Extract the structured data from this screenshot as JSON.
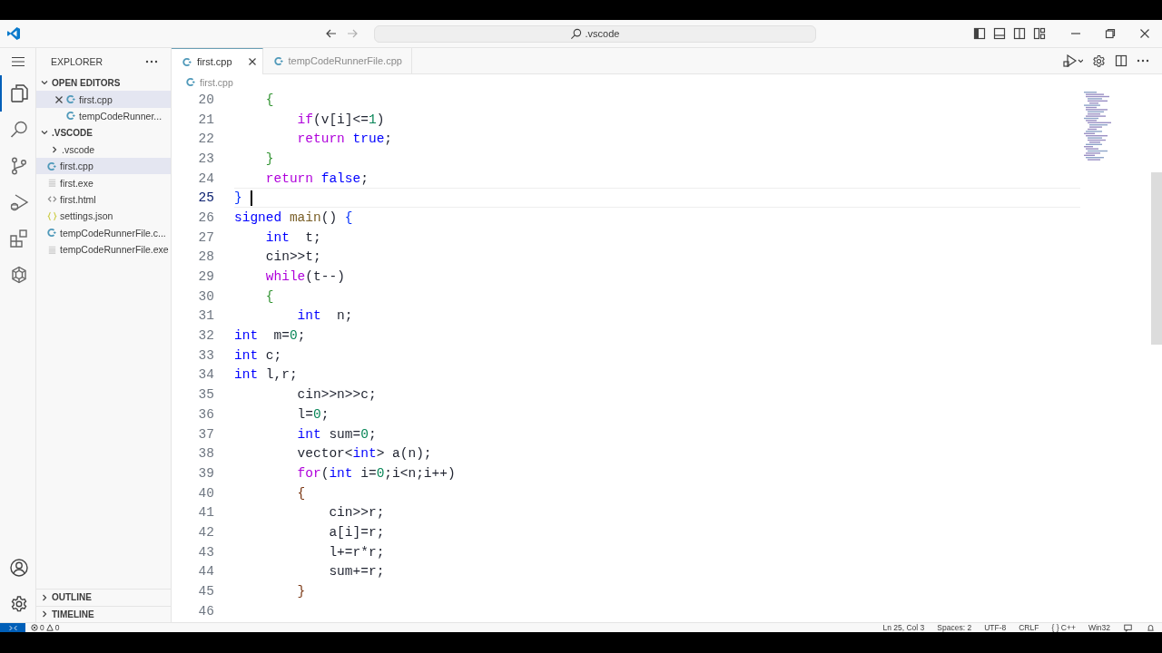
{
  "title_bar": {
    "search": ".vscode"
  },
  "activity_bar": {
    "items": [
      {
        "kind": "explorer",
        "selected": true
      },
      {
        "kind": "search",
        "selected": false
      },
      {
        "kind": "source-control",
        "selected": false
      },
      {
        "kind": "run-debug",
        "selected": false
      },
      {
        "kind": "extensions",
        "selected": false
      },
      {
        "kind": "assistant",
        "selected": false
      }
    ]
  },
  "explorer": {
    "title": "EXPLORER",
    "sections": [
      {
        "label": "OPEN EDITORS",
        "expanded": true,
        "items": [
          {
            "label": "first.cpp",
            "kind": "cpp",
            "selected": true
          },
          {
            "label": "tempCodeRunner...",
            "kind": "cpp",
            "selected": false
          }
        ]
      },
      {
        "label": ".VSCODE",
        "expanded": true,
        "items": [
          {
            "label": ".vscode",
            "kind": "folder",
            "expanded": false,
            "selected": false
          },
          {
            "label": "first.cpp",
            "kind": "cpp",
            "selected": true
          },
          {
            "label": "first.exe",
            "kind": "exe",
            "selected": false
          },
          {
            "label": "first.html",
            "kind": "html",
            "selected": false
          },
          {
            "label": "settings.json",
            "kind": "json",
            "selected": false
          },
          {
            "label": "tempCodeRunnerFile.c...",
            "kind": "cpp",
            "selected": false
          },
          {
            "label": "tempCodeRunnerFile.exe",
            "kind": "exe",
            "selected": false
          }
        ]
      }
    ],
    "bottom_sections": [
      {
        "label": "OUTLINE",
        "expanded": false
      },
      {
        "label": "TIMELINE",
        "expanded": false
      }
    ]
  },
  "editor": {
    "tabs": [
      {
        "label": "first.cpp",
        "selected": true
      },
      {
        "label": "tempCodeRunnerFile.cpp",
        "selected": false
      }
    ],
    "breadcrumb": "first.cpp",
    "lines": [
      {
        "number": "20",
        "current": false,
        "tokens": [
          {
            "kind": "bracket2",
            "text": "    {"
          }
        ]
      },
      {
        "number": "21",
        "current": false,
        "tokens": [
          {
            "kind": "keyword",
            "text": "        if"
          },
          {
            "kind": "plain",
            "text": "(v[i]<="
          },
          {
            "kind": "number",
            "text": "1"
          },
          {
            "kind": "plain",
            "text": ")"
          }
        ]
      },
      {
        "number": "22",
        "current": false,
        "tokens": [
          {
            "kind": "keyword",
            "text": "        return "
          },
          {
            "kind": "type",
            "text": "true"
          },
          {
            "kind": "plain",
            "text": ";"
          }
        ]
      },
      {
        "number": "23",
        "current": false,
        "tokens": [
          {
            "kind": "bracket2",
            "text": "    }"
          }
        ]
      },
      {
        "number": "24",
        "current": false,
        "tokens": [
          {
            "kind": "keyword",
            "text": "    return "
          },
          {
            "kind": "type",
            "text": "false"
          },
          {
            "kind": "plain",
            "text": ";"
          }
        ]
      },
      {
        "number": "25",
        "current": true,
        "tokens": [
          {
            "kind": "bracket1",
            "text": "}"
          }
        ]
      },
      {
        "number": "26",
        "current": false,
        "tokens": [
          {
            "kind": "type",
            "text": "signed "
          },
          {
            "kind": "function",
            "text": "main"
          },
          {
            "kind": "plain",
            "text": "() "
          },
          {
            "kind": "bracket1",
            "text": "{"
          }
        ]
      },
      {
        "number": "27",
        "current": false,
        "tokens": [
          {
            "kind": "type",
            "text": "    int"
          },
          {
            "kind": "plain",
            "text": "  t;"
          }
        ]
      },
      {
        "number": "28",
        "current": false,
        "tokens": [
          {
            "kind": "plain",
            "text": "    cin>>t;"
          }
        ]
      },
      {
        "number": "29",
        "current": false,
        "tokens": [
          {
            "kind": "keyword",
            "text": "    while"
          },
          {
            "kind": "plain",
            "text": "(t--)"
          }
        ]
      },
      {
        "number": "30",
        "current": false,
        "tokens": [
          {
            "kind": "bracket2",
            "text": "    {"
          }
        ]
      },
      {
        "number": "31",
        "current": false,
        "tokens": [
          {
            "kind": "type",
            "text": "        int"
          },
          {
            "kind": "plain",
            "text": "  n;"
          }
        ]
      },
      {
        "number": "32",
        "current": false,
        "tokens": [
          {
            "kind": "type",
            "text": "int"
          },
          {
            "kind": "plain",
            "text": "  m="
          },
          {
            "kind": "number",
            "text": "0"
          },
          {
            "kind": "plain",
            "text": ";"
          }
        ]
      },
      {
        "number": "33",
        "current": false,
        "tokens": [
          {
            "kind": "type",
            "text": "int"
          },
          {
            "kind": "plain",
            "text": " c;"
          }
        ]
      },
      {
        "number": "34",
        "current": false,
        "tokens": [
          {
            "kind": "type",
            "text": "int"
          },
          {
            "kind": "plain",
            "text": " l,r;"
          }
        ]
      },
      {
        "number": "35",
        "current": false,
        "tokens": [
          {
            "kind": "plain",
            "text": "        cin>>n>>c;"
          }
        ]
      },
      {
        "number": "36",
        "current": false,
        "tokens": [
          {
            "kind": "plain",
            "text": "        l="
          },
          {
            "kind": "number",
            "text": "0"
          },
          {
            "kind": "plain",
            "text": ";"
          }
        ]
      },
      {
        "number": "37",
        "current": false,
        "tokens": [
          {
            "kind": "type",
            "text": "        int"
          },
          {
            "kind": "plain",
            "text": " sum="
          },
          {
            "kind": "number",
            "text": "0"
          },
          {
            "kind": "plain",
            "text": ";"
          }
        ]
      },
      {
        "number": "38",
        "current": false,
        "tokens": [
          {
            "kind": "plain",
            "text": "        vector<"
          },
          {
            "kind": "type",
            "text": "int"
          },
          {
            "kind": "plain",
            "text": "> a(n);"
          }
        ]
      },
      {
        "number": "39",
        "current": false,
        "tokens": [
          {
            "kind": "keyword",
            "text": "        for"
          },
          {
            "kind": "plain",
            "text": "("
          },
          {
            "kind": "type",
            "text": "int"
          },
          {
            "kind": "plain",
            "text": " i="
          },
          {
            "kind": "number",
            "text": "0"
          },
          {
            "kind": "plain",
            "text": ";i<n;i++)"
          }
        ]
      },
      {
        "number": "40",
        "current": false,
        "tokens": [
          {
            "kind": "bracket3",
            "text": "        {"
          }
        ]
      },
      {
        "number": "41",
        "current": false,
        "tokens": [
          {
            "kind": "plain",
            "text": "            cin>>r;"
          }
        ]
      },
      {
        "number": "42",
        "current": false,
        "tokens": [
          {
            "kind": "plain",
            "text": "            a[i]=r;"
          }
        ]
      },
      {
        "number": "43",
        "current": false,
        "tokens": [
          {
            "kind": "plain",
            "text": "            l+=r*r;"
          }
        ]
      },
      {
        "number": "44",
        "current": false,
        "tokens": [
          {
            "kind": "plain",
            "text": "            sum+=r;"
          }
        ]
      },
      {
        "number": "45",
        "current": false,
        "tokens": [
          {
            "kind": "bracket3",
            "text": "        }"
          }
        ]
      },
      {
        "number": "46",
        "current": false
      }
    ]
  },
  "status_bar": {
    "errors": "0",
    "warnings": "0",
    "items": [
      "Ln 25, Col 3",
      "Spaces: 2",
      "UTF-8",
      "CRLF",
      "{ } C++",
      "Win32"
    ]
  }
}
